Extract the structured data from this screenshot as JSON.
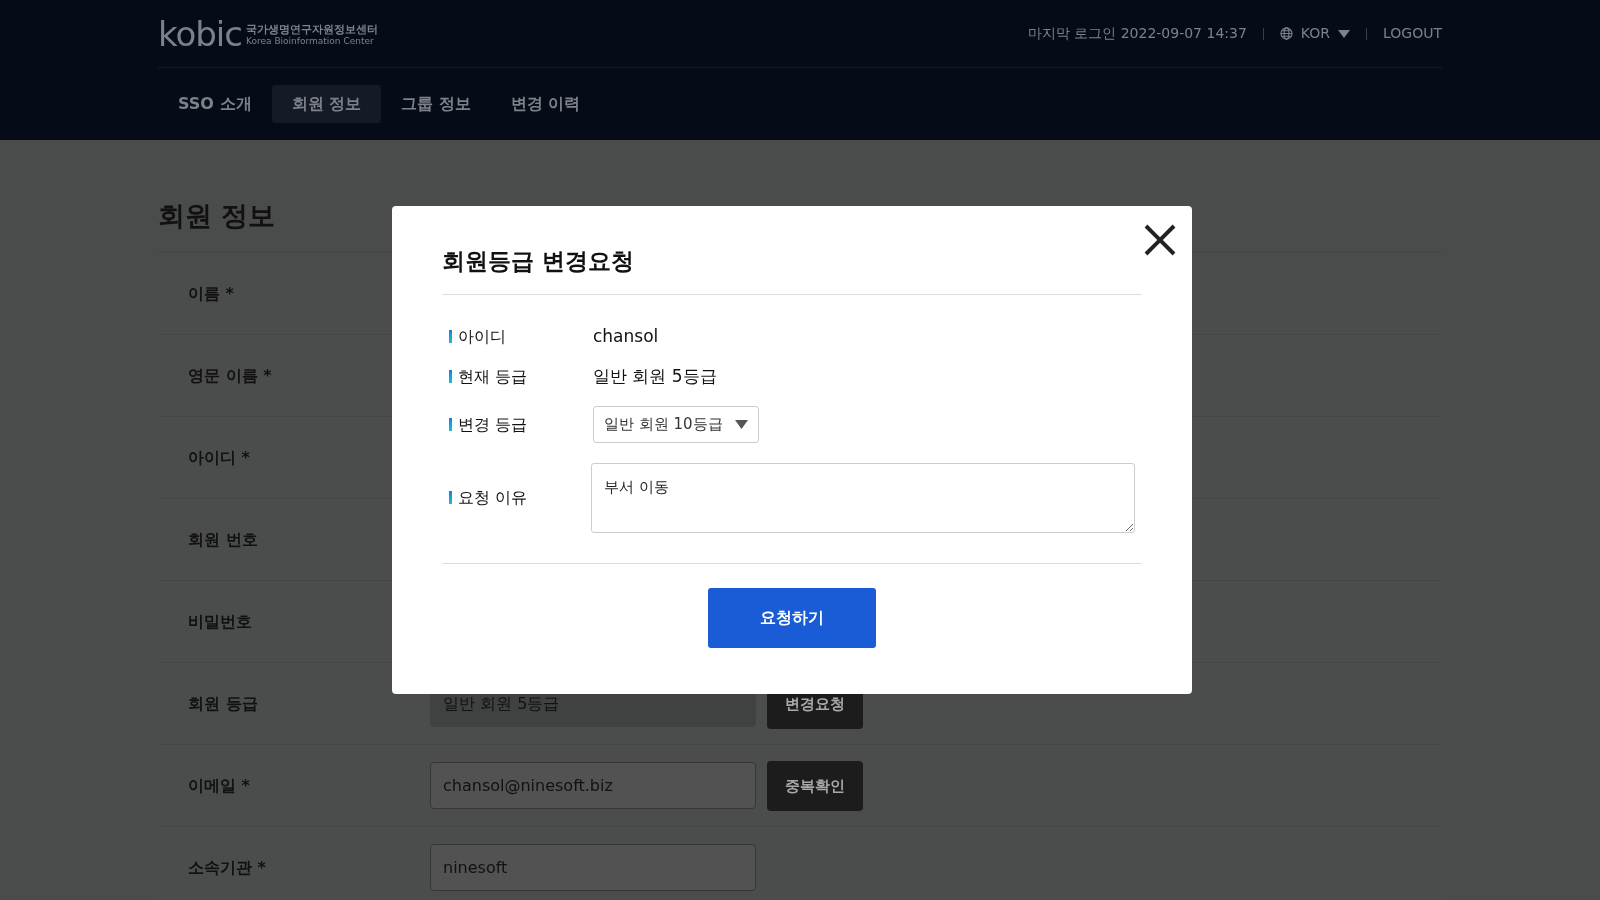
{
  "header": {
    "logo": {
      "wordmark": "kobic",
      "name_ko": "국가생명연구자원정보센터",
      "name_en": "Korea Bioinformation Center"
    },
    "last_login": "마지막 로그인 2022-09-07 14:37",
    "language": "KOR",
    "logout": "LOGOUT"
  },
  "nav": [
    {
      "label": "SSO 소개",
      "selected": false
    },
    {
      "label": "회원 정보",
      "selected": true
    },
    {
      "label": "그룹 정보",
      "selected": false
    },
    {
      "label": "변경 이력",
      "selected": false
    }
  ],
  "page_title": "회원 정보",
  "form_rows": [
    {
      "label": "이름 *"
    },
    {
      "label": "영문 이름 *"
    },
    {
      "label": "아이디 *"
    },
    {
      "label": "회원 번호"
    },
    {
      "label": "비밀번호"
    },
    {
      "label": "회원 등급",
      "value": "일반 회원 5등급",
      "readonly": true,
      "button": "변경요청"
    },
    {
      "label": "이메일 *",
      "value": "chansol@ninesoft.biz",
      "readonly": false,
      "button": "중복확인"
    },
    {
      "label": "소속기관 *",
      "value": "ninesoft",
      "readonly": false
    }
  ],
  "modal": {
    "title": "회원등급 변경요청",
    "fields": [
      {
        "kind": "text",
        "label": "아이디",
        "value": "chansol"
      },
      {
        "kind": "text",
        "label": "현재 등급",
        "value": "일반 회원 5등급"
      },
      {
        "kind": "select",
        "label": "변경 등급",
        "value": "일반 회원 10등급"
      },
      {
        "kind": "textarea",
        "label": "요청 이유",
        "value": "부서 이동"
      }
    ],
    "submit": "요청하기"
  }
}
